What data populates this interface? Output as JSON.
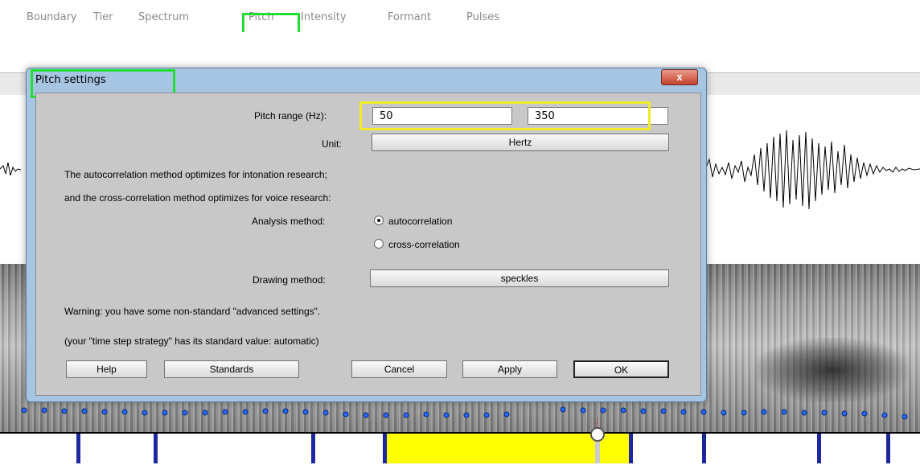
{
  "menu": {
    "items": [
      {
        "label": "Boundary"
      },
      {
        "label": "Tier"
      },
      {
        "label": "Spectrum"
      },
      {
        "label": "Pitch"
      },
      {
        "label": "Intensity"
      },
      {
        "label": "Formant"
      },
      {
        "label": "Pulses"
      }
    ]
  },
  "dialog": {
    "title": "Pitch settings",
    "close_label": "x",
    "pitch_range": {
      "label": "Pitch range (Hz):",
      "floor": "50",
      "ceiling": "350"
    },
    "unit": {
      "label": "Unit:",
      "value": "Hertz"
    },
    "info_line_1": "The autocorrelation method optimizes for intonation research;",
    "info_line_2": "and the cross-correlation method optimizes for voice research:",
    "analysis_method": {
      "label": "Analysis method:",
      "option_1": "autocorrelation",
      "option_2": "cross-correlation",
      "selected": "autocorrelation"
    },
    "drawing_method": {
      "label": "Drawing method:",
      "value": "speckles"
    },
    "warning_1": "Warning: you have some non-standard \"advanced settings\".",
    "warning_2": "(your \"time step strategy\" has its standard value: automatic)",
    "buttons": {
      "help": "Help",
      "standards": "Standards",
      "cancel": "Cancel",
      "apply": "Apply",
      "ok": "OK"
    }
  },
  "colors": {
    "highlight_green": "#22dd33",
    "highlight_yellow": "#f1ea2a",
    "selection": "#ffff00",
    "boundary": "#1c27a0",
    "pitch_dots": "#2a66ff"
  }
}
